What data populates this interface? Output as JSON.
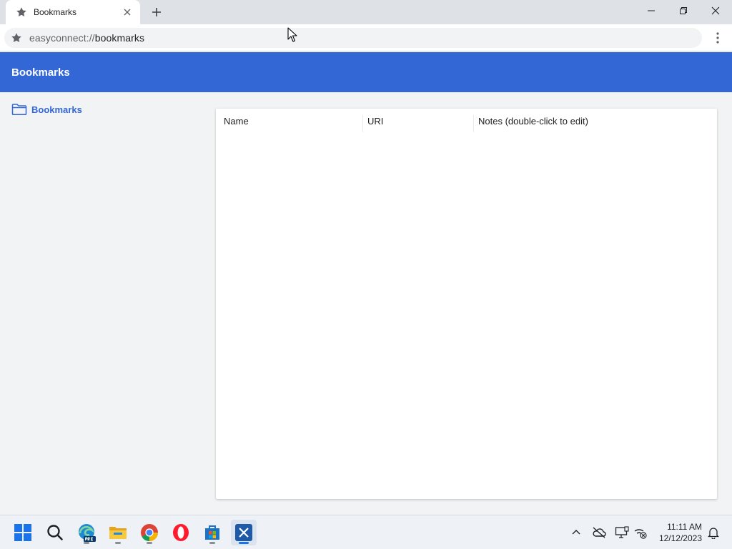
{
  "browser": {
    "tab_title": "Bookmarks",
    "url_scheme": "easyconnect://",
    "url_host": "bookmarks"
  },
  "page": {
    "header_title": "Bookmarks",
    "folder_tree": [
      {
        "label": "Bookmarks",
        "icon": "folder-icon"
      }
    ],
    "columns": {
      "name": "Name",
      "uri": "URI",
      "notes": "Notes (double-click to edit)"
    },
    "rows": []
  },
  "taskbar": {
    "apps": [
      "start-icon",
      "search-icon",
      "edge-beta-icon",
      "file-explorer-icon",
      "chrome-icon",
      "opera-icon",
      "store-icon",
      "easyconnect-icon"
    ],
    "tray": [
      "chevron-up-icon",
      "onedrive-off-icon",
      "display-icon",
      "network-off-icon"
    ],
    "time": "11:11 AM",
    "date": "12/12/2023"
  },
  "colors": {
    "accent": "#3367d6",
    "tab_strip": "#dee1e6",
    "page_bg": "#f1f3f4"
  }
}
